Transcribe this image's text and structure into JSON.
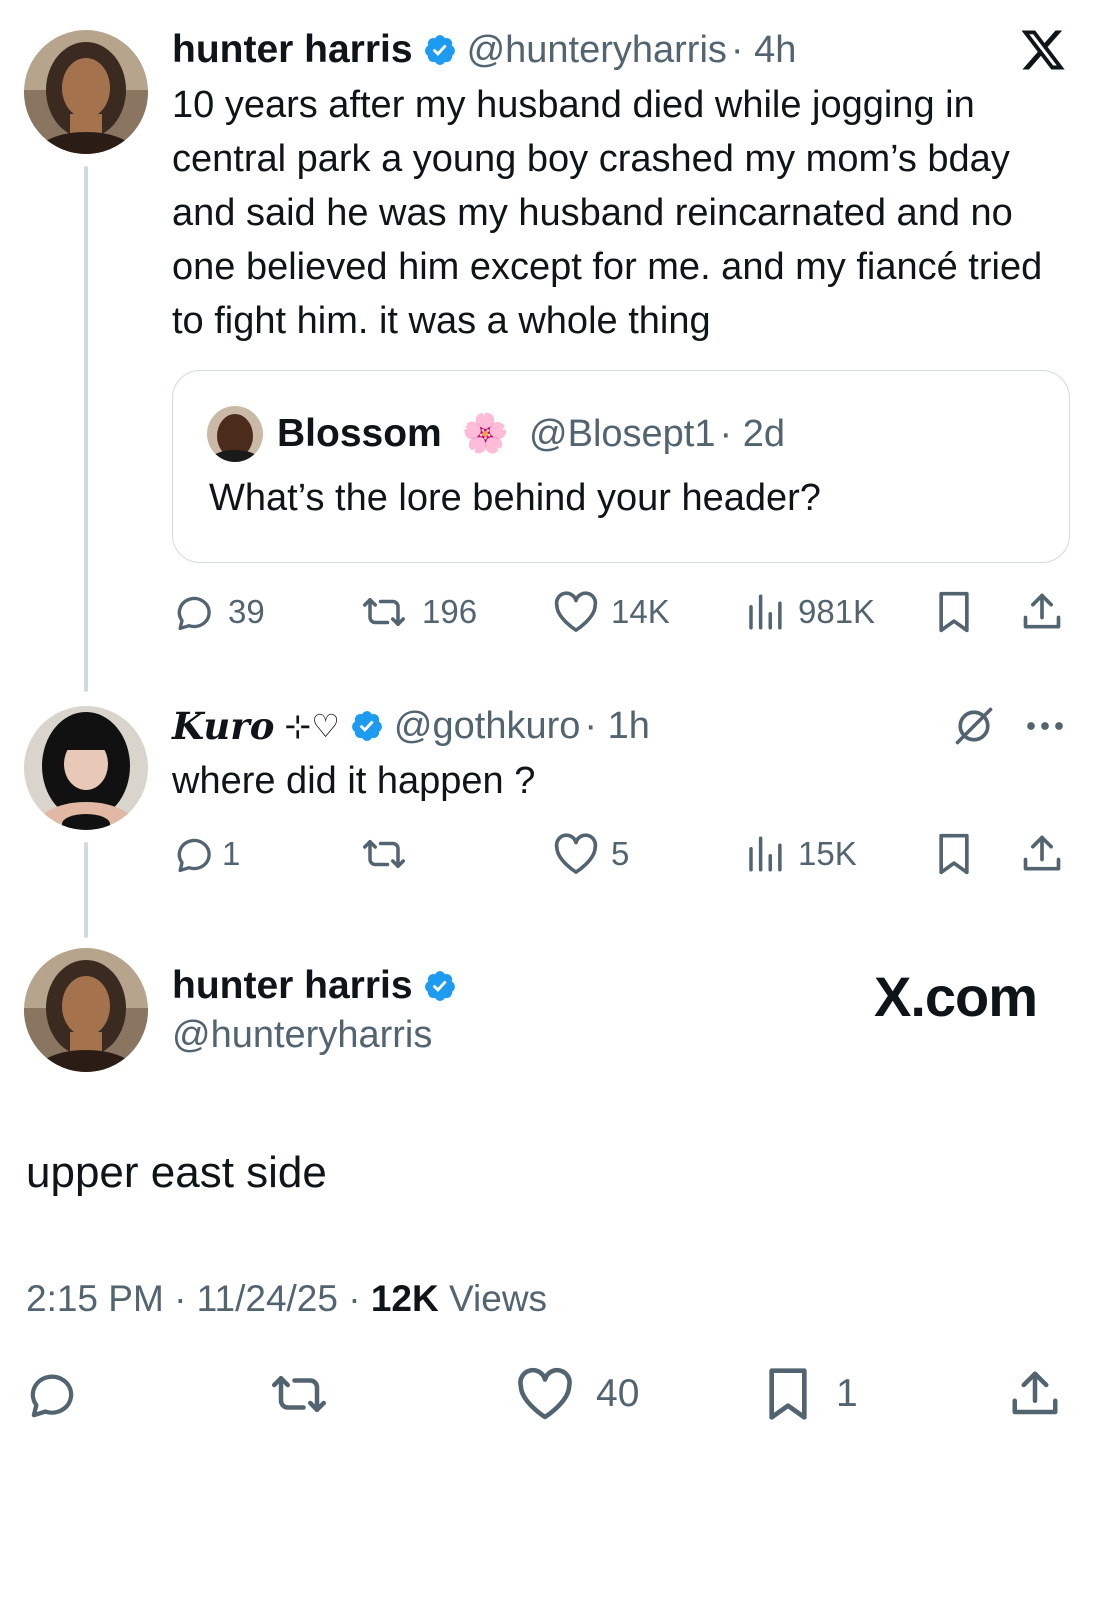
{
  "main_tweet": {
    "author_name": "hunter harris",
    "author_handle": "@hunteryharris",
    "time": "· 4h",
    "text": "10 years after my husband died while jogging in central park a young boy crashed my mom’s bday and said he was my husband reincarnated and no one believed him except for me. and my fiancé tried to fight him. it was a whole thing",
    "quote": {
      "author_name": "Blossom",
      "author_emoji": "🌸",
      "author_handle": "@Blosept1",
      "time": "· 2d",
      "text": "What’s the lore behind your header?"
    },
    "stats": {
      "replies": "39",
      "reposts": "196",
      "likes": "14K",
      "views": "981K"
    }
  },
  "reply_tweet": {
    "author_name": "Kuro",
    "author_decoration": "⊹♡",
    "author_handle": "@gothkuro",
    "time": "· 1h",
    "text": "where did it happen ?",
    "stats": {
      "replies": "1",
      "reposts": "",
      "likes": "5",
      "views": "15K"
    }
  },
  "focused_tweet": {
    "author_name": "hunter harris",
    "author_handle": "@hunteryharris",
    "brand": "X.com",
    "text": "upper east side",
    "timestamp": "2:15 PM · 11/24/25 · ",
    "views_count": "12K",
    "views_label": " Views",
    "stats": {
      "replies": "",
      "reposts": "",
      "likes": "40",
      "bookmarks": "1"
    }
  },
  "icons": {
    "x_logo": "x-logo-icon",
    "verified": "verified-badge-icon",
    "reply": "reply-icon",
    "repost": "repost-icon",
    "like": "heart-icon",
    "views": "views-chart-icon",
    "bookmark": "bookmark-icon",
    "share": "share-icon",
    "grok": "grok-icon",
    "more": "more-dots-icon"
  },
  "colors": {
    "verified": "#1d9bf0",
    "text": "#0f1419",
    "secondary": "#536471",
    "divider": "#cfd9de"
  }
}
